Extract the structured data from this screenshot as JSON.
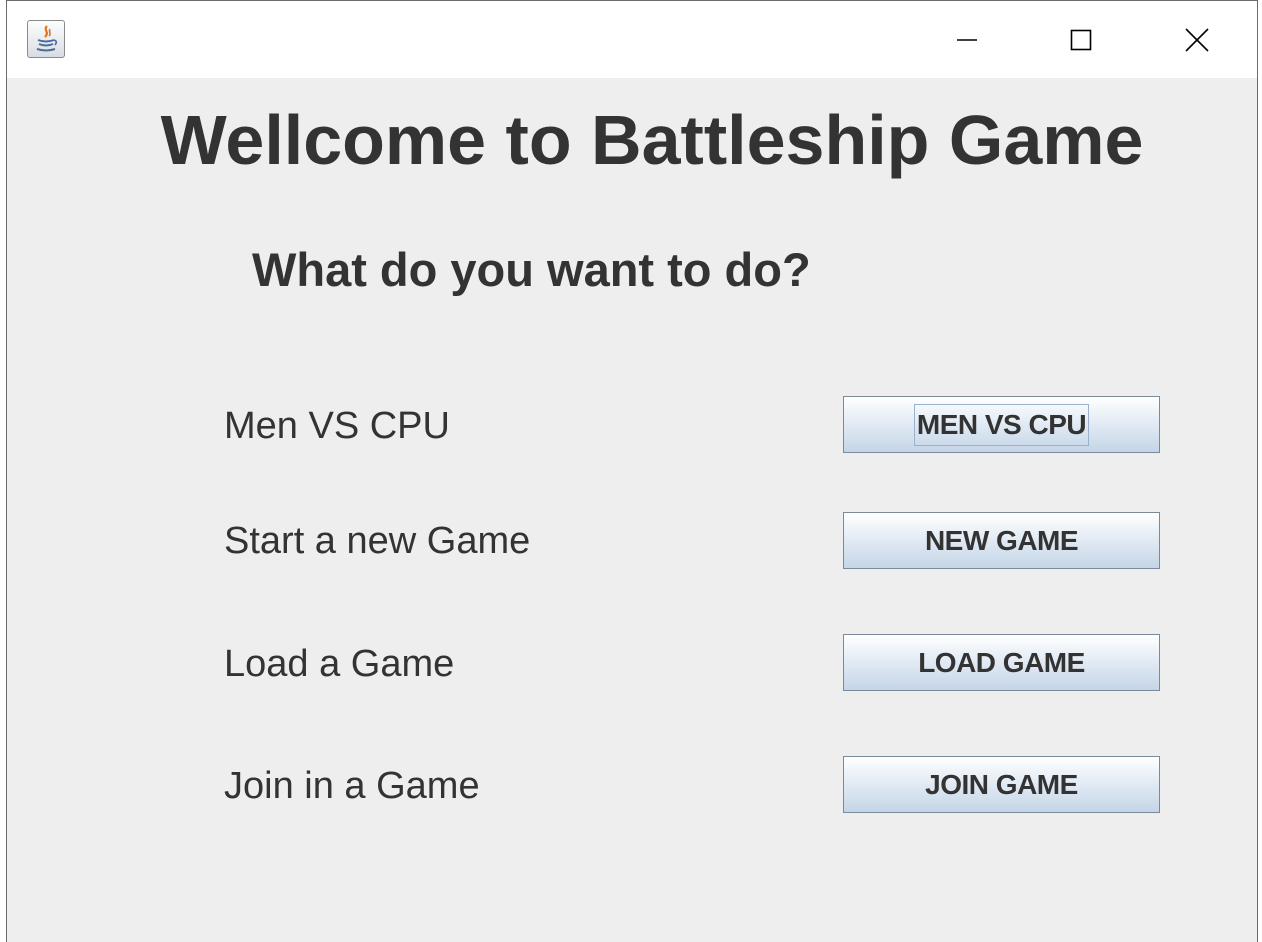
{
  "window": {
    "icon": "java-icon",
    "controls": {
      "minimize": "minimize-icon",
      "maximize": "maximize-icon",
      "close": "close-icon"
    }
  },
  "main": {
    "title": "Wellcome to Battleship Game",
    "question": "What do you want to do?",
    "options": [
      {
        "label": "Men VS CPU",
        "button": "MEN VS CPU",
        "focused": true
      },
      {
        "label": "Start a new Game",
        "button": "NEW GAME",
        "focused": false
      },
      {
        "label": "Load a Game",
        "button": "LOAD GAME",
        "focused": false
      },
      {
        "label": "Join in a Game",
        "button": "JOIN GAME",
        "focused": false
      }
    ]
  },
  "colors": {
    "background": "#eeeeee",
    "text": "#333333",
    "button_border": "#7a8a99",
    "button_gradient_bottom": "#c4d5e7"
  }
}
